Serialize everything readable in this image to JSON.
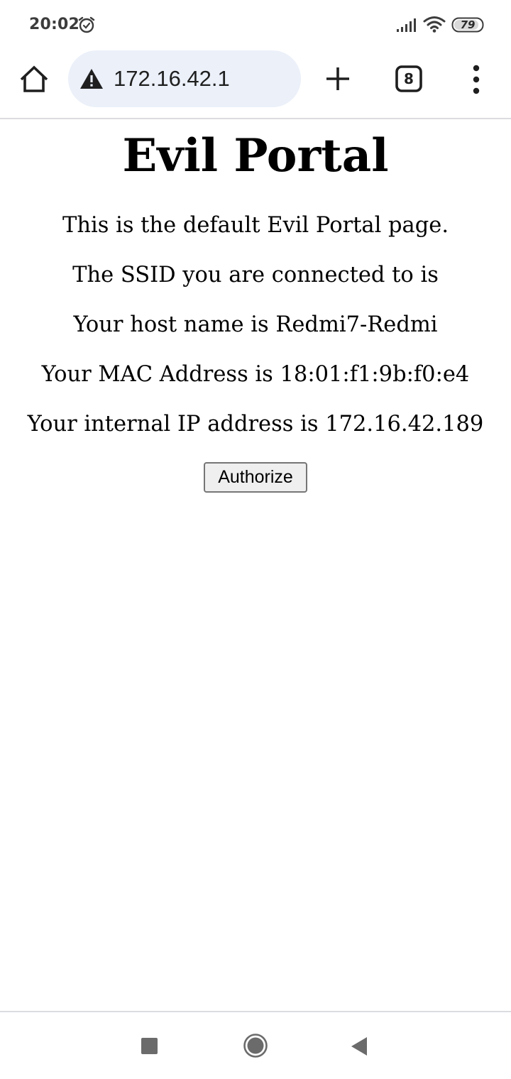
{
  "status_bar": {
    "time": "20:02",
    "battery_level": "79",
    "icons": [
      "alarm-icon",
      "signal-icon",
      "wifi-icon",
      "battery-icon"
    ]
  },
  "toolbar": {
    "url": "172.16.42.1",
    "tab_count": "8",
    "icons": [
      "home-icon",
      "warning-icon",
      "plus-icon",
      "tab-switcher-icon",
      "more-vert-icon"
    ]
  },
  "page": {
    "title": "Evil Portal",
    "lines": [
      "This is the default Evil Portal page.",
      "The SSID you are connected to is",
      "Your host name is Redmi7-Redmi",
      "Your MAC Address is 18:01:f1:9b:f0:e4",
      "Your internal IP address is 172.16.42.189"
    ],
    "authorize_label": "Authorize"
  },
  "nav_bar": {
    "icons": [
      "recents-icon",
      "home-circle-icon",
      "back-icon"
    ]
  },
  "colors": {
    "omnibox_bg": "#ebf0f9",
    "text": "#000000",
    "icon": "#1f1f1f",
    "nav_icon": "#6b6b6b"
  }
}
